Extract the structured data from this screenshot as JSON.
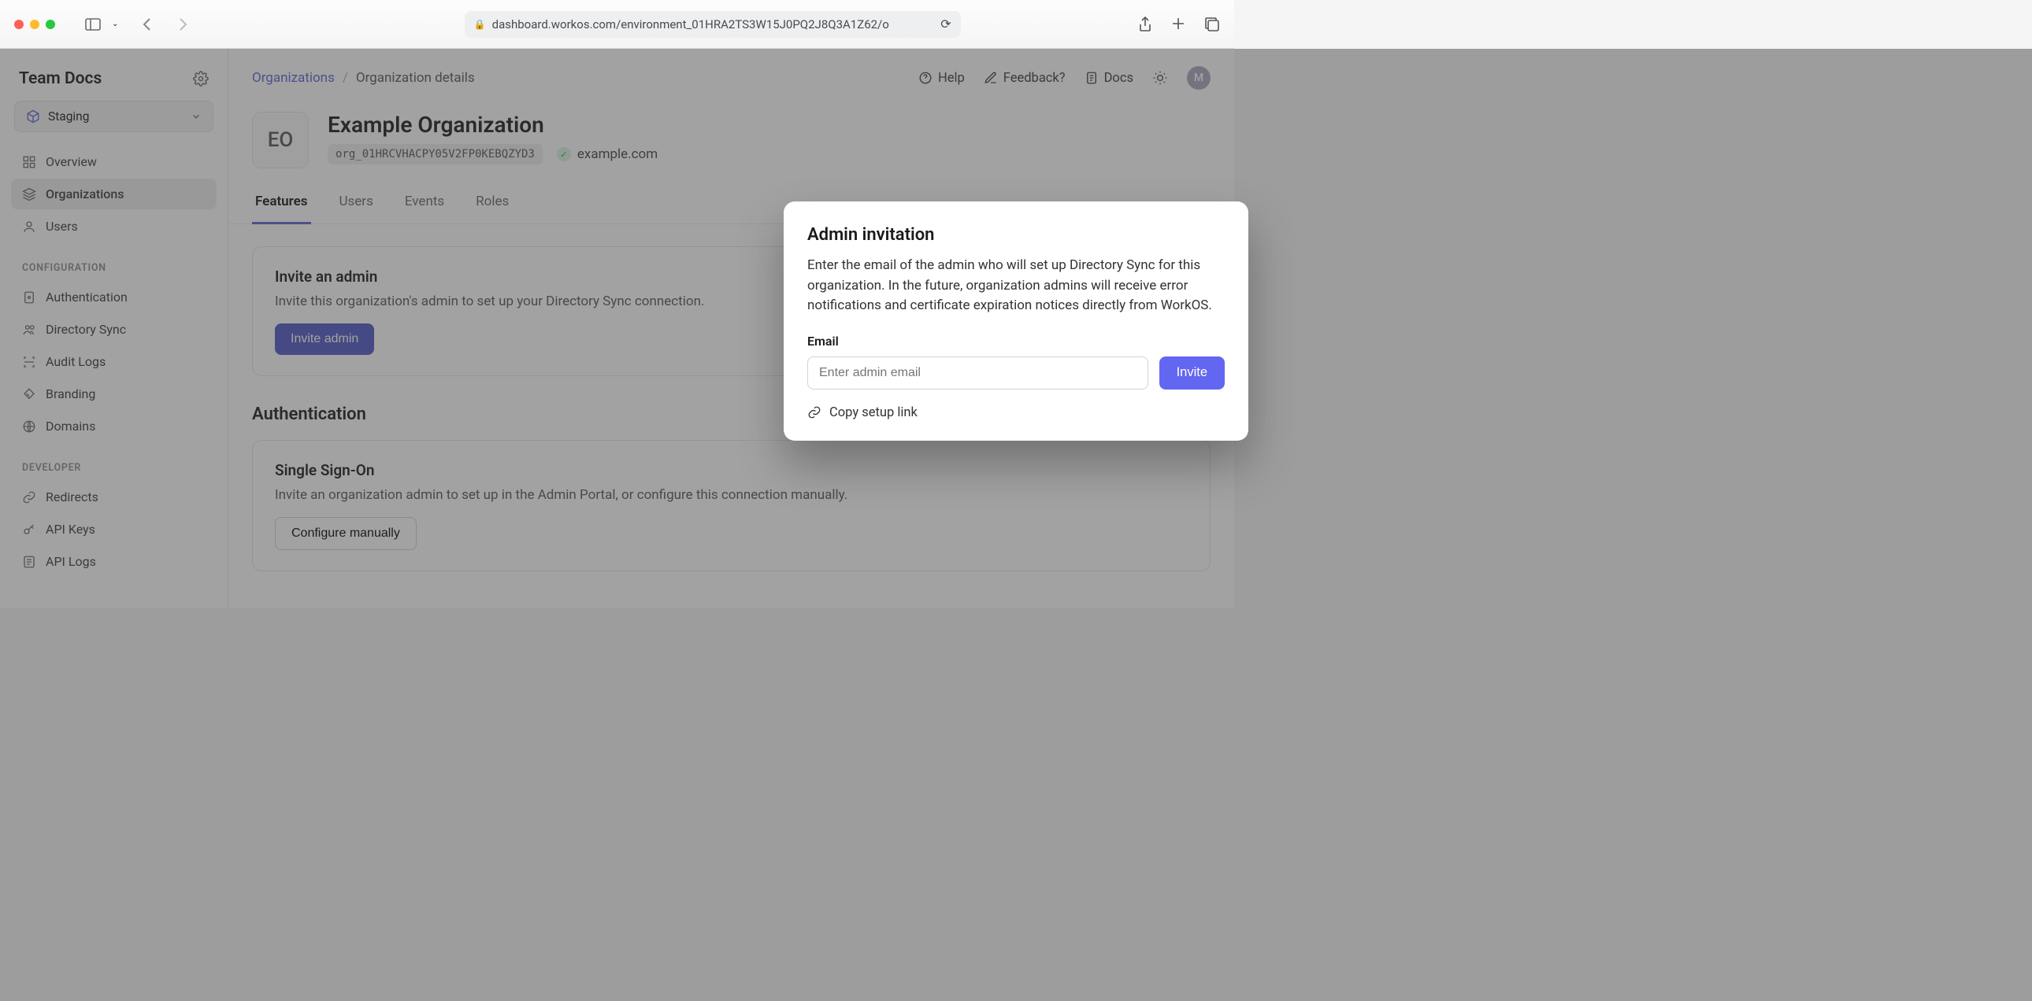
{
  "browser": {
    "url": "dashboard.workos.com/environment_01HRA2TS3W15J0PQ2J8Q3A1Z62/o"
  },
  "sidebar": {
    "title": "Team Docs",
    "env": "Staging",
    "nav_main": [
      {
        "label": "Overview"
      },
      {
        "label": "Organizations"
      },
      {
        "label": "Users"
      }
    ],
    "section_config": "CONFIGURATION",
    "nav_config": [
      {
        "label": "Authentication"
      },
      {
        "label": "Directory Sync"
      },
      {
        "label": "Audit Logs"
      },
      {
        "label": "Branding"
      },
      {
        "label": "Domains"
      }
    ],
    "section_dev": "DEVELOPER",
    "nav_dev": [
      {
        "label": "Redirects"
      },
      {
        "label": "API Keys"
      },
      {
        "label": "API Logs"
      }
    ]
  },
  "breadcrumb": {
    "root": "Organizations",
    "current": "Organization details"
  },
  "top_actions": {
    "help": "Help",
    "feedback": "Feedback?",
    "docs": "Docs",
    "avatar": "M"
  },
  "org": {
    "badge": "EO",
    "name": "Example Organization",
    "id": "org_01HRCVHACPY05V2FP0KEBQZYD3",
    "domain": "example.com"
  },
  "tabs": [
    "Features",
    "Users",
    "Events",
    "Roles"
  ],
  "card_invite": {
    "title": "Invite an admin",
    "body": "Invite this organization's admin to set up your Directory Sync connection.",
    "button": "Invite admin"
  },
  "auth_section": {
    "heading": "Authentication",
    "sso_title": "Single Sign-On",
    "sso_body": "Invite an organization admin to set up in the Admin Portal, or configure this connection manually.",
    "configure": "Configure manually"
  },
  "modal": {
    "title": "Admin invitation",
    "body": "Enter the email of the admin who will set up Directory Sync for this organization. In the future, organization admins will receive error notifications and certificate expiration notices directly from WorkOS.",
    "email_label": "Email",
    "email_placeholder": "Enter admin email",
    "invite": "Invite",
    "copy": "Copy setup link"
  }
}
